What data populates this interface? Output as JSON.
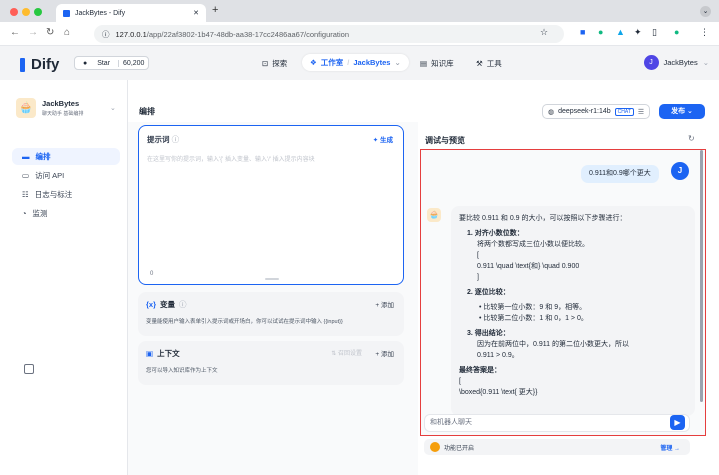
{
  "browser": {
    "tab_title": "JackBytes - Dify",
    "new_tab": "+",
    "url_host": "127.0.0.1",
    "url_path": "/app/22af3802-1b47-48db-aa38-17cc2486aa67/configuration",
    "colors": {
      "close": "#ff5f57",
      "minimize": "#febc2e",
      "maximize": "#28c840"
    }
  },
  "header": {
    "logo": "Dify",
    "star_label": "Star",
    "star_count": "60,200",
    "nav": {
      "explore": "探索",
      "studio": "工作室",
      "studio_app": "JackBytes",
      "knowledge": "知识库",
      "tools": "工具"
    },
    "user_initial": "J",
    "user_name": "JackBytes"
  },
  "sidebar": {
    "app_name": "JackBytes",
    "app_sub": "聊天助手  基础编排",
    "items": [
      {
        "label": "编排",
        "icon": "orchestrate-icon",
        "active": true
      },
      {
        "label": "访问 API",
        "icon": "api-icon",
        "active": false
      },
      {
        "label": "日志与标注",
        "icon": "logs-icon",
        "active": false
      },
      {
        "label": "监测",
        "icon": "monitor-icon",
        "active": false
      }
    ]
  },
  "main": {
    "title": "编排",
    "model_name": "deepseek-r1:14b",
    "model_badge": "CHAT",
    "publish": "发布",
    "prompt": {
      "title": "提示词",
      "generate": "生成",
      "placeholder": "在这里写你的提示词，输入'{' 插入变量、输入'/' 插入提示内容块",
      "count": "0"
    },
    "variables": {
      "title": "变量",
      "add": "+ 添加",
      "desc": "变量能使用户输入表单引入提示词或开场白，你可以试试在提示词中输入 {{input}}"
    },
    "context": {
      "title": "上下文",
      "settings": "召回设置",
      "add": "+ 添加",
      "desc": "您可以导入知识库作为上下文"
    }
  },
  "preview": {
    "title": "调试与预览",
    "user_initial": "J",
    "user_message": "0.911和0.9哪个更大",
    "answer": {
      "intro": "要比较 0.911 和 0.9 的大小，可以按照以下步骤进行：",
      "step1_title": "1. 对齐小数位数：",
      "step1_text": "将两个数都写成三位小数以便比较。",
      "step1_l1": "[",
      "step1_l2": "0.911 \\quad \\text{和} \\quad 0.900",
      "step1_l3": "]",
      "step2_title": "2. 逐位比较：",
      "step2_b1": "比较第一位小数：9 和 9，相等。",
      "step2_b2": "比较第二位小数：1 和 0，1 > 0。",
      "step3_title": "3. 得出结论：",
      "step3_text": "因为在前两位中，0.911 的第二位小数更大，所以",
      "step3_text2": "0.911 > 0.9。",
      "final": "最终答案是：",
      "final_l1": "[",
      "final_l2": "\\boxed{0.911 \\text{ 更大}}"
    },
    "input_placeholder": "和机器人聊天",
    "feature_text": "功能已开启",
    "manage": "管理 →"
  }
}
